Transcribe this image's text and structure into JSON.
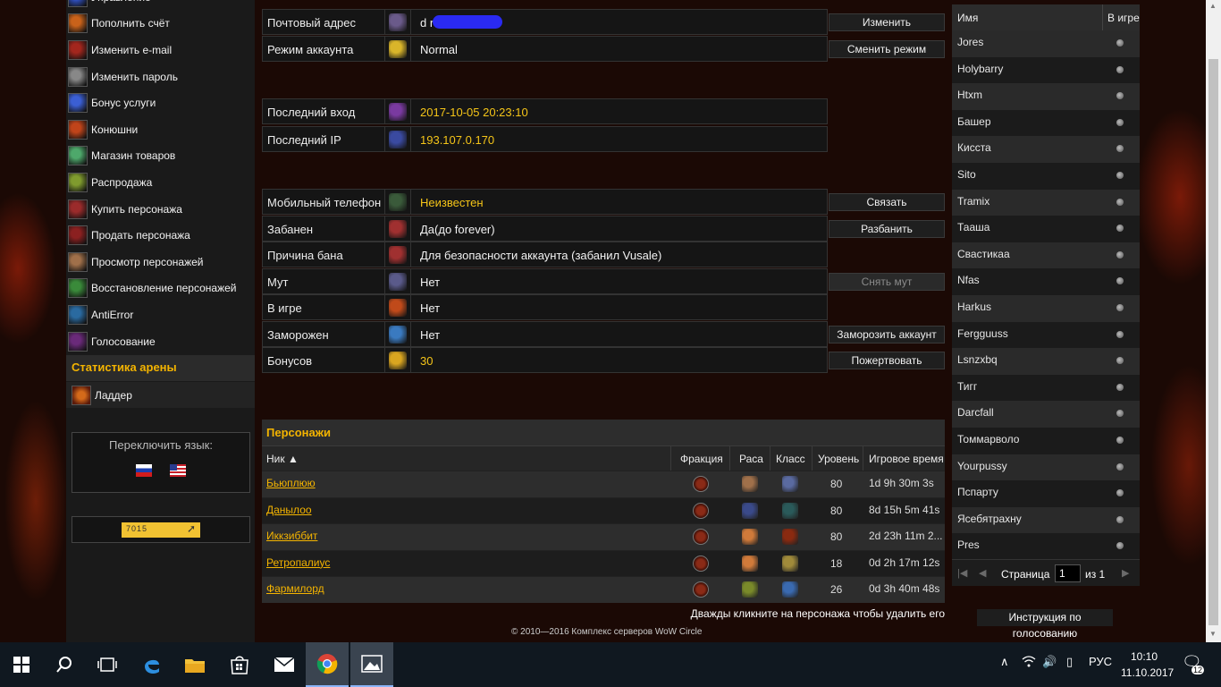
{
  "sidebar": {
    "menu": [
      {
        "label": "Управление",
        "icon": "management-icon",
        "color": "#2f4fbf"
      },
      {
        "label": "Пополнить счёт",
        "icon": "topup-icon",
        "color": "#c9621a"
      },
      {
        "label": "Изменить e-mail",
        "icon": "email-icon",
        "color": "#a3261d"
      },
      {
        "label": "Изменить пароль",
        "icon": "password-icon",
        "color": "#888888"
      },
      {
        "label": "Бонус услуги",
        "icon": "bonus-icon",
        "color": "#3b5fd4"
      },
      {
        "label": "Конюшни",
        "icon": "stables-icon",
        "color": "#c0441a"
      },
      {
        "label": "Магазин товаров",
        "icon": "shop-icon",
        "color": "#4ea86b"
      },
      {
        "label": "Распродажа",
        "icon": "sale-icon",
        "color": "#7f9b2e"
      },
      {
        "label": "Купить персонажа",
        "icon": "buy-character-icon",
        "color": "#9b2b2b"
      },
      {
        "label": "Продать персонажа",
        "icon": "sell-character-icon",
        "color": "#8b2020"
      },
      {
        "label": "Просмотр персонажей",
        "icon": "view-characters-icon",
        "color": "#a0704a"
      },
      {
        "label": "Восстановление персонажей",
        "icon": "restore-characters-icon",
        "color": "#3a8a3a"
      },
      {
        "label": "AntiError",
        "icon": "antierror-icon",
        "color": "#2a6aa0"
      },
      {
        "label": "Голосование",
        "icon": "vote-icon",
        "color": "#6a2a7a"
      }
    ],
    "arena_title": "Статистика арены",
    "ladder_label": "Ладдер",
    "lang_title": "Переключить язык:",
    "counter_text": "7015"
  },
  "account": {
    "rows": [
      {
        "label": "Почтовый адрес",
        "value": "d ru",
        "value_style": "white",
        "icon": "mail-icon",
        "icon_color": "#6a5a8a",
        "button": "Изменить",
        "redacted": true
      },
      {
        "label": "Режим аккаунта",
        "value": "Normal",
        "value_style": "white",
        "icon": "star-icon",
        "icon_color": "#d9b52a",
        "button": "Сменить режим"
      },
      {
        "label": "Последний вход",
        "value": "2017-10-05 20:23:10",
        "value_style": "gold",
        "icon": "login-icon",
        "icon_color": "#7a3aa0"
      },
      {
        "label": "Последний IP",
        "value": "193.107.0.170",
        "value_style": "gold",
        "icon": "ip-icon",
        "icon_color": "#3a4aa0"
      },
      {
        "label": "Мобильный телефон",
        "value": "Неизвестен",
        "value_style": "gold",
        "icon": "phone-icon",
        "icon_color": "#3a5a3a",
        "button": "Связать"
      },
      {
        "label": "Забанен",
        "value": "Да(до forever)",
        "value_style": "white",
        "icon": "ban-icon",
        "icon_color": "#a03030",
        "button": "Разбанить"
      },
      {
        "label": "Причина бана",
        "value": "Для безопасности аккаунта (забанил Vusale)",
        "value_style": "white",
        "icon": "ban-reason-icon",
        "icon_color": "#a03030"
      },
      {
        "label": "Мут",
        "value": "Нет",
        "value_style": "white",
        "icon": "mute-icon",
        "icon_color": "#5a5a8a",
        "button": "Снять мут",
        "disabled": true
      },
      {
        "label": "В игре",
        "value": "Нет",
        "value_style": "white",
        "icon": "ingame-icon",
        "icon_color": "#c04a1a"
      },
      {
        "label": "Заморожен",
        "value": "Нет",
        "value_style": "white",
        "icon": "frozen-icon",
        "icon_color": "#3a7ac0",
        "button": "Заморозить аккаунт"
      },
      {
        "label": "Бонусов",
        "value": "30",
        "value_style": "gold",
        "icon": "coin-icon",
        "icon_color": "#d9a520",
        "button": "Пожертвовать"
      }
    ]
  },
  "characters": {
    "title": "Персонажи",
    "columns": {
      "nick": "Ник ▲",
      "faction": "Фракция",
      "race": "Раса",
      "class": "Класс",
      "level": "Уровень",
      "playtime": "Игровое время"
    },
    "rows": [
      {
        "name": "Бьюплюю",
        "level": "80",
        "time": "1d 9h 30m 3s",
        "race_color": "#a0704a",
        "class_color": "#5a6aa0"
      },
      {
        "name": "Данылоо",
        "level": "80",
        "time": "8d 15h 5m 41s",
        "race_color": "#3a4a8a",
        "class_color": "#2a5a5a"
      },
      {
        "name": "Иккзиббит",
        "level": "80",
        "time": "2d 23h 11m 2...",
        "race_color": "#d07a3a",
        "class_color": "#8a2a10"
      },
      {
        "name": "Ретропалиус",
        "level": "18",
        "time": "0d 2h 17m 12s",
        "race_color": "#d07a3a",
        "class_color": "#a08a3a"
      },
      {
        "name": "Фармилорд",
        "level": "26",
        "time": "0d 3h 40m 48s",
        "race_color": "#7a8a2a",
        "class_color": "#3a6ab0"
      }
    ],
    "delete_hint": "Дважды кликните на персонажа чтобы удалить его"
  },
  "footer": {
    "copyright": "© 2010—2016 Комплекс серверов WoW Circle"
  },
  "online": {
    "col_name": "Имя",
    "col_ingame": "В игре",
    "players": [
      "Jores",
      "Holybarry",
      "Htxm",
      "Башер",
      "Кисста",
      "Sito",
      "Tramix",
      "Тааша",
      "Свастикаа",
      "Nfas",
      "Harkus",
      "Fergguuss",
      "Lsnzxbq",
      "Тигг",
      "Darcfall",
      "Томмарволо",
      "Yourpussy",
      "Пспарту",
      "Ясебятрахну",
      "Pres"
    ],
    "pager": {
      "page_label": "Страница",
      "page_value": "1",
      "of_label": "из 1"
    },
    "vote_button": "Инструкция по голосованию"
  },
  "taskbar": {
    "lang": "РУС",
    "time": "10:10",
    "date": "11.10.2017",
    "notif_count": "12"
  }
}
